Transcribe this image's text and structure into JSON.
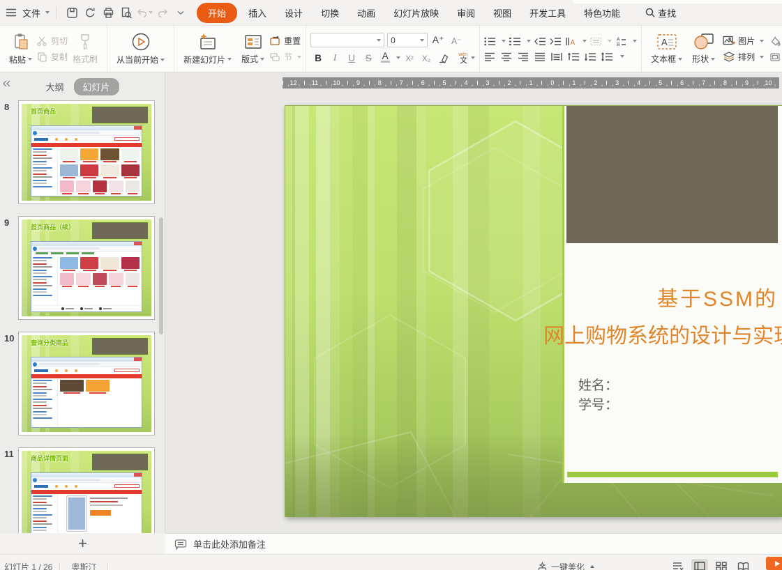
{
  "menu": {
    "file": "文件",
    "tabs": [
      {
        "label": "开始",
        "active": true
      },
      {
        "label": "插入",
        "active": false
      },
      {
        "label": "设计",
        "active": false
      },
      {
        "label": "切换",
        "active": false
      },
      {
        "label": "动画",
        "active": false
      },
      {
        "label": "幻灯片放映",
        "active": false
      },
      {
        "label": "审阅",
        "active": false
      },
      {
        "label": "视图",
        "active": false
      },
      {
        "label": "开发工具",
        "active": false
      },
      {
        "label": "特色功能",
        "active": false
      }
    ],
    "search": "查找",
    "active_tab_color": "#ea5c14"
  },
  "ribbon": {
    "paste": "粘贴",
    "cut": "剪切",
    "copy": "复制",
    "format_painter": "格式刷",
    "play_from_current": "从当前开始",
    "new_slide": "新建幻灯片",
    "layout": "版式",
    "reset": "重置",
    "section": "节",
    "font_name": "",
    "font_size": "0",
    "bold": "B",
    "italic": "I",
    "underline": "U",
    "strike": "S",
    "font_color": "A",
    "superscript": "X²",
    "subscript": "X₂",
    "phonetic_char": "文",
    "phonetic_pinyin": "wén",
    "textbox": "文本框",
    "shapes": "形状",
    "picture": "图片",
    "arrange": "排列",
    "fill_clipped": "填",
    "outline_clipped": "轮"
  },
  "sidebar": {
    "outline_tab": "大纲",
    "slides_tab": "幻灯片",
    "add_slide": "+",
    "slides": [
      {
        "num": "8",
        "title": "首页商品",
        "variant": "home1"
      },
      {
        "num": "9",
        "title": "首页商品（续）",
        "variant": "home2"
      },
      {
        "num": "10",
        "title": "查询分类商品",
        "variant": "category"
      },
      {
        "num": "11",
        "title": "商品详情页面",
        "variant": "detail"
      }
    ]
  },
  "ruler": {
    "numbers": [
      "12",
      "11",
      "10",
      "9",
      "8",
      "7",
      "6",
      "5",
      "4",
      "3",
      "2",
      "1",
      "0",
      "1",
      "2",
      "3",
      "4",
      "5",
      "6",
      "7",
      "8",
      "9",
      "10"
    ]
  },
  "slide": {
    "title_line1": "基于SSM的",
    "title_line2": "网上购物系统的设计与实现",
    "name_label": "姓名：",
    "id_label": "学号：",
    "colors": {
      "title": "#e1852a",
      "accent_bar": "#9aca3b",
      "panel": "#fbfbf7",
      "brown": "#6f6758",
      "green_border": "#a6c94f"
    }
  },
  "thumb_mock": {
    "side_colors": [
      "#4a86c8",
      "#b0b0b0",
      "#c9453c",
      "#9a9a9a",
      "#4a86c8",
      "#c2c2c2"
    ],
    "price_color": "#d9433b",
    "variants": {
      "home1": {
        "logo": true,
        "nav": true,
        "sidebar": true,
        "rows": [
          [
            "#eef3ec",
            "#f5a636",
            "#6d5233",
            "#f0f5ef"
          ],
          [
            "#9cb6d6",
            "#cc3b44",
            "#efe9df",
            "#a8333f"
          ],
          [
            "#f3b9c9",
            "#f7d3dd",
            "#b53340",
            "#f2e3e8",
            "#ece9e5"
          ]
        ]
      },
      "home2": {
        "greenrow": true,
        "sidebar": true,
        "footer": true,
        "rows": [
          [
            "#8fb9e2",
            "#ce3f48",
            "#efe8d8",
            "#b23048"
          ],
          [
            "#f2b9c9",
            "#f7d6e0",
            "#bf4a5a",
            "#f3d3da",
            "#ece9e5"
          ]
        ]
      },
      "category": {
        "logo": true,
        "nav": true,
        "sidebar": true,
        "narrow": true,
        "rows": [
          [
            "#5d4936",
            "#f3a233"
          ]
        ]
      },
      "detail": {
        "logo": true,
        "nav": true,
        "sidebar": true,
        "phone": true,
        "button_color": "#f08228",
        "phone_screen": "#9db8d8"
      }
    }
  },
  "notes": {
    "placeholder": "单击此处添加备注"
  },
  "statusbar": {
    "slide_counter": "幻灯片 1 / 26",
    "theme": "奥斯汀",
    "beautify": "一键美化"
  },
  "icons": [
    "hamburger-icon",
    "save-icon",
    "export-icon",
    "print-icon",
    "print-preview-icon",
    "undo-icon",
    "redo-icon",
    "more-icon",
    "search-icon",
    "paste-icon",
    "scissors-icon",
    "copy-icon",
    "format-painter-icon",
    "play-circle-icon",
    "new-slide-icon",
    "layout-icon",
    "reset-icon",
    "section-icon",
    "increase-font-icon",
    "decrease-font-icon",
    "font-color-icon",
    "clear-format-icon",
    "phonetic-icon",
    "bullet-list-icon",
    "numbered-list-icon",
    "decrease-indent-icon",
    "increase-indent-icon",
    "text-direction-icon",
    "text-box-style-icon",
    "char-style-icon",
    "align-left-icon",
    "align-center-icon",
    "align-right-icon",
    "justify-icon",
    "distribute-icon",
    "row-spacing-up-icon",
    "row-spacing-down-icon",
    "line-spacing-icon",
    "textbox-icon",
    "shapes-icon",
    "picture-icon",
    "arrange-icon",
    "fill-icon",
    "outline-icon",
    "collapse-icon",
    "notes-icon",
    "beautify-icon",
    "notes-toggle-icon",
    "normal-view-icon",
    "slide-sorter-icon",
    "reading-view-icon",
    "slideshow-icon",
    "add-slide-icon"
  ]
}
